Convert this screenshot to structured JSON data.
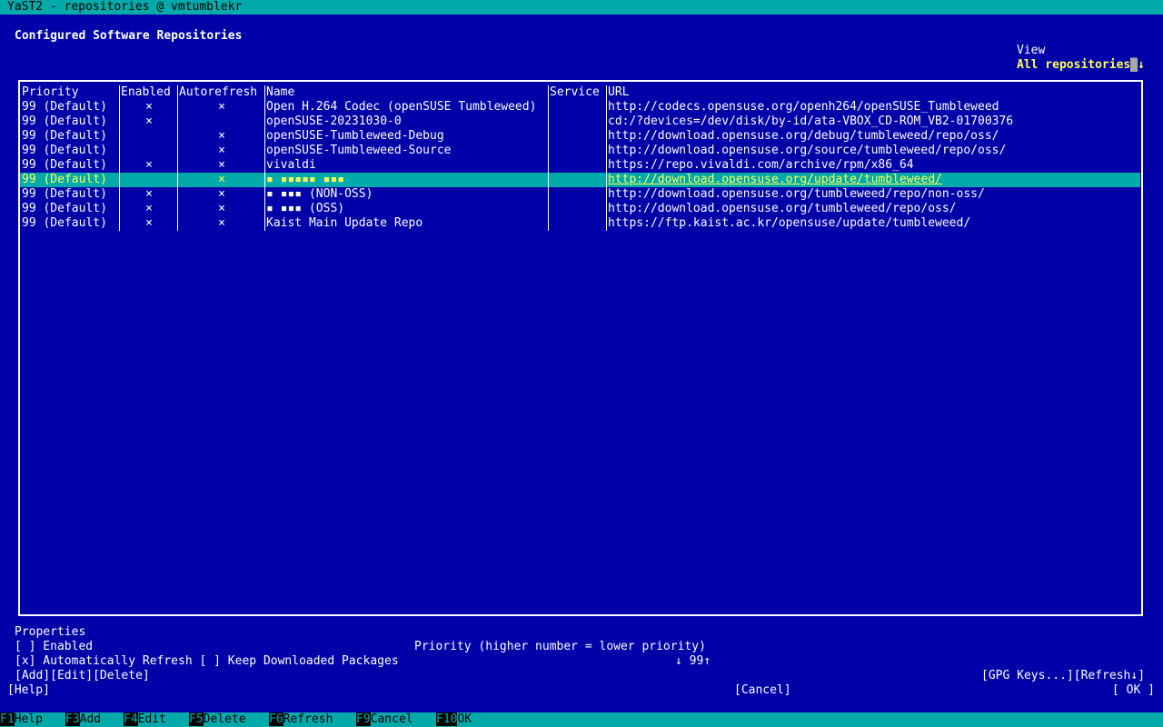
{
  "window": {
    "title": "YaST2 - repositories @ vmtumblekr"
  },
  "heading": "Configured Software Repositories",
  "view": {
    "label": "View",
    "value": "All repositories",
    "arrow": "↓"
  },
  "table": {
    "columns": [
      "Priority",
      "Enabled",
      "Autorefresh",
      "Name",
      "Service",
      "URL"
    ],
    "rows": [
      {
        "priority": "99 (Default)",
        "enabled": "×",
        "autorefresh": "×",
        "name": "Open H.264 Codec (openSUSE Tumbleweed)",
        "service": "",
        "url": "http://codecs.opensuse.org/openh264/openSUSE_Tumbleweed"
      },
      {
        "priority": "99 (Default)",
        "enabled": "×",
        "autorefresh": "",
        "name": "openSUSE-20231030-0",
        "service": "",
        "url": "cd:/?devices=/dev/disk/by-id/ata-VBOX_CD-ROM_VB2-01700376"
      },
      {
        "priority": "99 (Default)",
        "enabled": "",
        "autorefresh": "×",
        "name": "openSUSE-Tumbleweed-Debug",
        "service": "",
        "url": "http://download.opensuse.org/debug/tumbleweed/repo/oss/"
      },
      {
        "priority": "99 (Default)",
        "enabled": "",
        "autorefresh": "×",
        "name": "openSUSE-Tumbleweed-Source",
        "service": "",
        "url": "http://download.opensuse.org/source/tumbleweed/repo/oss/"
      },
      {
        "priority": "99 (Default)",
        "enabled": "×",
        "autorefresh": "×",
        "name": "vivaldi",
        "service": "",
        "url": "https://repo.vivaldi.com/archive/rpm/x86_64"
      },
      {
        "priority": "99 (Default)",
        "enabled": "",
        "autorefresh": "×",
        "name": "▪ ▪▪▪▪▪ ▪▪▪",
        "service": "",
        "url": "http://download.opensuse.org/update/tumbleweed/"
      },
      {
        "priority": "99 (Default)",
        "enabled": "×",
        "autorefresh": "×",
        "name": "▪ ▪▪▪ (NON-OSS)",
        "service": "",
        "url": "http://download.opensuse.org/tumbleweed/repo/non-oss/"
      },
      {
        "priority": "99 (Default)",
        "enabled": "×",
        "autorefresh": "×",
        "name": "▪ ▪▪▪ (OSS)",
        "service": "",
        "url": "http://download.opensuse.org/tumbleweed/repo/oss/"
      },
      {
        "priority": "99 (Default)",
        "enabled": "×",
        "autorefresh": "×",
        "name": "Kaist Main Update Repo",
        "service": "",
        "url": "https://ftp.kaist.ac.kr/opensuse/update/tumbleweed/"
      }
    ],
    "selected_row": 5
  },
  "properties": {
    "label": "Properties",
    "enabled_checkbox": "[ ] Enabled",
    "auto_refresh_checkbox": "[x] Automatically Refresh",
    "keep_packages_checkbox": "[ ] Keep Downloaded Packages",
    "priority_label": "Priority (higher number = lower priority)",
    "priority_value": "99",
    "priority_down": "↓",
    "priority_up": "↑"
  },
  "buttons": {
    "add": "[Add]",
    "edit": "[Edit]",
    "delete": "[Delete]",
    "gpg_keys": "[GPG Keys...]",
    "refresh": "[Refresh↓]",
    "help": "[Help]",
    "cancel": "[Cancel]",
    "ok": "[ OK ]"
  },
  "fkeys": [
    {
      "key": "F1",
      "label": "Help"
    },
    {
      "key": "F3",
      "label": "Add"
    },
    {
      "key": "F4",
      "label": "Edit"
    },
    {
      "key": "F5",
      "label": "Delete"
    },
    {
      "key": "F6",
      "label": "Refresh"
    },
    {
      "key": "F9",
      "label": "Cancel"
    },
    {
      "key": "F10",
      "label": "OK"
    }
  ],
  "colors": {
    "background": "#0000a8",
    "bar": "#00aaaa",
    "highlight": "#ffff55",
    "text": "#ffffff"
  }
}
